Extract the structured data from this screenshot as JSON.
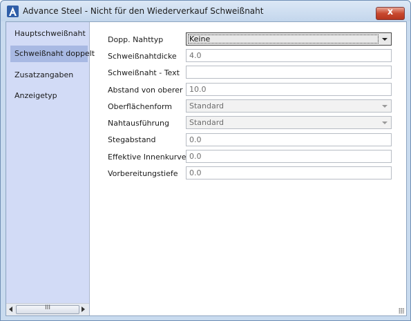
{
  "window": {
    "title": "Advance Steel - Nicht für den Wiederverkauf  Schweißnaht",
    "close_symbol": "x"
  },
  "sidebar": {
    "items": [
      {
        "label": "Hauptschweißnaht"
      },
      {
        "label": "Schweißnaht doppelt"
      },
      {
        "label": "Zusatzangaben"
      },
      {
        "label": "Anzeigetyp"
      }
    ],
    "selected": "Schweißnaht doppelt",
    "scroll_thumb_text": "III"
  },
  "form": {
    "dopp_nahttyp": {
      "label": "Dopp. Nahttyp",
      "value": "Keine"
    },
    "schweissnahtdicke": {
      "label": "Schweißnahtdicke",
      "value": "4.0"
    },
    "schweissnaht_text": {
      "label": "Schweißnaht - Text",
      "value": ""
    },
    "abstand_von_oberer": {
      "label": "Abstand von oberer",
      "value": "10.0"
    },
    "oberflaechenform": {
      "label": "Oberflächenform",
      "value": "Standard"
    },
    "nahtausfuehrung": {
      "label": "Nahtausführung",
      "value": "Standard"
    },
    "stegabstand": {
      "label": "Stegabstand",
      "value": "0.0"
    },
    "effektive_innenkurve": {
      "label": "Effektive Innenkurve",
      "value": "0.0"
    },
    "vorbereitungstiefe": {
      "label": "Vorbereitungstiefe",
      "value": "0.0"
    }
  },
  "colors": {
    "title_bar": "#c9dbef",
    "sidebar_bg": "#d2dbf6",
    "sidebar_selected": "#a8b9e3",
    "close_button": "#c8492f"
  },
  "icons": [
    "advance-steel-logo-icon",
    "close-icon",
    "scroll-left-icon",
    "scroll-right-icon",
    "dropdown-arrow-icon",
    "resize-grip-icon"
  ]
}
